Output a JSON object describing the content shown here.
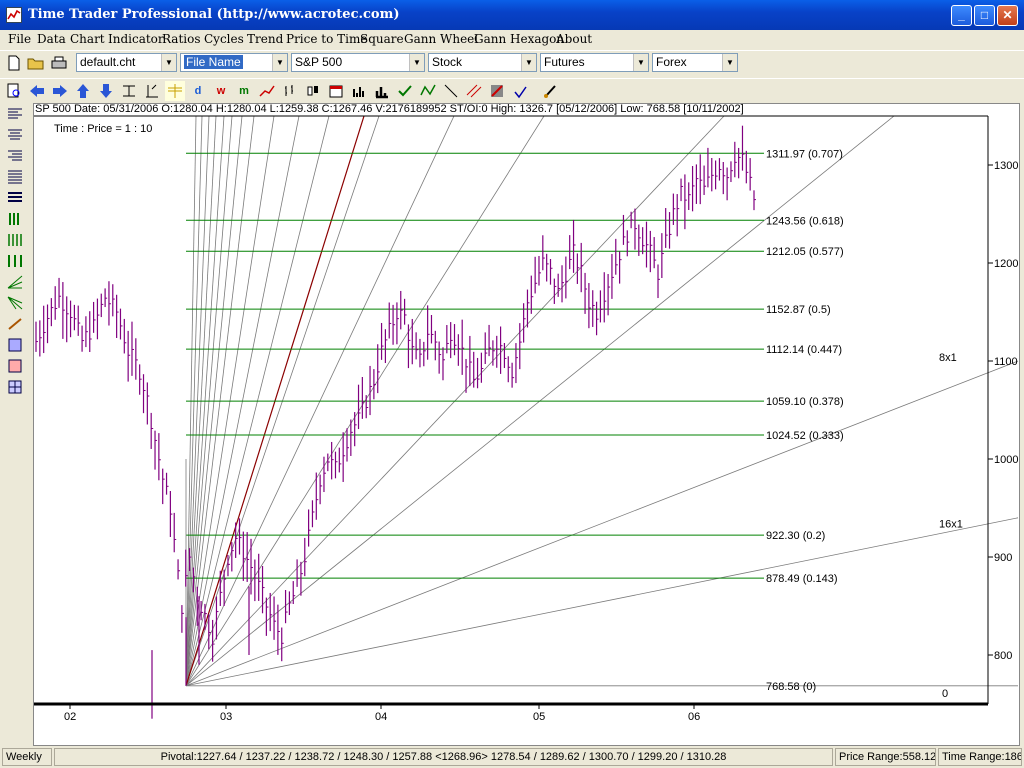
{
  "window": {
    "title": "Time Trader Professional (http://www.acrotec.com)",
    "minimize_glyph": "_",
    "maximize_glyph": "□",
    "close_glyph": "✕"
  },
  "menu": [
    "File",
    "Data",
    "Chart",
    "Indicator",
    "Ratios",
    "Cycles",
    "Trend",
    "Price to Time",
    "Square",
    "Gann Wheel",
    "Gann Hexagon",
    "About"
  ],
  "toolbar": {
    "chart_file": "default.cht",
    "file_name": "File Name",
    "symbol": "S&P 500",
    "stock": "Stock",
    "futures": "Futures",
    "forex": "Forex",
    "d_label": "d",
    "w_label": "w",
    "m_label": "m"
  },
  "colors": {
    "price_bars": "#800080",
    "fib_lines": "#008000",
    "gann_lines": "#7a7a7a",
    "primary_gann": "#8b0000"
  },
  "info_line": "SP 500  Date: 05/31/2006 O:1280.04  H:1280.04  L:1259.38  C:1267.46  V:2176189952 ST/OI:0       High: 1326.7 [05/12/2006]  Low: 768.58 [10/11/2002]",
  "chart_data": {
    "type": "bar",
    "subtitle": "Time : Price = 1 : 10",
    "y_ticks": [
      "1300",
      "1200",
      "1100",
      "1000",
      "900",
      "800"
    ],
    "x_ticks": [
      "02",
      "03",
      "04",
      "05",
      "06"
    ],
    "ylim": [
      750,
      1350
    ],
    "fib_levels": [
      {
        "price": 1311.97,
        "label": "1311.97  (0.707)"
      },
      {
        "price": 1243.56,
        "label": "1243.56  (0.618)"
      },
      {
        "price": 1212.05,
        "label": "1212.05  (0.577)"
      },
      {
        "price": 1152.87,
        "label": "1152.87  (0.5)"
      },
      {
        "price": 1112.14,
        "label": "1112.14  (0.447)"
      },
      {
        "price": 1059.1,
        "label": "1059.10  (0.378)"
      },
      {
        "price": 1024.52,
        "label": "1024.52  (0.333)"
      },
      {
        "price": 922.3,
        "label": "922.30  (0.2)"
      },
      {
        "price": 878.49,
        "label": "878.49  (0.143)"
      },
      {
        "price": 768.58,
        "label": "768.58  (0)"
      }
    ],
    "fan_labels": [
      "8x1",
      "16x1",
      "0"
    ],
    "price_series": [
      {
        "t": 0,
        "p": 1120
      },
      {
        "t": 3,
        "p": 1145
      },
      {
        "t": 6,
        "p": 1165
      },
      {
        "t": 9,
        "p": 1150
      },
      {
        "t": 12,
        "p": 1120
      },
      {
        "t": 15,
        "p": 1135
      },
      {
        "t": 18,
        "p": 1165
      },
      {
        "t": 21,
        "p": 1150
      },
      {
        "t": 24,
        "p": 1110
      },
      {
        "t": 27,
        "p": 1090
      },
      {
        "t": 29,
        "p": 1060
      },
      {
        "t": 31,
        "p": 1020
      },
      {
        "t": 33,
        "p": 980
      },
      {
        "t": 35,
        "p": 950
      },
      {
        "t": 37,
        "p": 880
      },
      {
        "t": 38,
        "p": 850
      },
      {
        "t": 40,
        "p": 900
      },
      {
        "t": 42,
        "p": 860
      },
      {
        "t": 44,
        "p": 840
      },
      {
        "t": 46,
        "p": 820
      },
      {
        "t": 48,
        "p": 860
      },
      {
        "t": 50,
        "p": 900
      },
      {
        "t": 52,
        "p": 920
      },
      {
        "t": 54,
        "p": 905
      },
      {
        "t": 56,
        "p": 890
      },
      {
        "t": 58,
        "p": 870
      },
      {
        "t": 60,
        "p": 850
      },
      {
        "t": 62,
        "p": 830
      },
      {
        "t": 64,
        "p": 820
      },
      {
        "t": 66,
        "p": 850
      },
      {
        "t": 68,
        "p": 870
      },
      {
        "t": 70,
        "p": 900
      },
      {
        "t": 72,
        "p": 940
      },
      {
        "t": 74,
        "p": 980
      },
      {
        "t": 76,
        "p": 1000
      },
      {
        "t": 78,
        "p": 990
      },
      {
        "t": 80,
        "p": 1010
      },
      {
        "t": 82,
        "p": 1030
      },
      {
        "t": 84,
        "p": 1040
      },
      {
        "t": 86,
        "p": 1060
      },
      {
        "t": 88,
        "p": 1080
      },
      {
        "t": 90,
        "p": 1110
      },
      {
        "t": 92,
        "p": 1130
      },
      {
        "t": 94,
        "p": 1150
      },
      {
        "t": 96,
        "p": 1145
      },
      {
        "t": 98,
        "p": 1110
      },
      {
        "t": 100,
        "p": 1100
      },
      {
        "t": 102,
        "p": 1130
      },
      {
        "t": 104,
        "p": 1120
      },
      {
        "t": 106,
        "p": 1100
      },
      {
        "t": 108,
        "p": 1130
      },
      {
        "t": 110,
        "p": 1120
      },
      {
        "t": 112,
        "p": 1100
      },
      {
        "t": 114,
        "p": 1080
      },
      {
        "t": 116,
        "p": 1090
      },
      {
        "t": 118,
        "p": 1110
      },
      {
        "t": 120,
        "p": 1120
      },
      {
        "t": 122,
        "p": 1110
      },
      {
        "t": 124,
        "p": 1090
      },
      {
        "t": 126,
        "p": 1120
      },
      {
        "t": 128,
        "p": 1160
      },
      {
        "t": 130,
        "p": 1180
      },
      {
        "t": 132,
        "p": 1200
      },
      {
        "t": 134,
        "p": 1190
      },
      {
        "t": 136,
        "p": 1170
      },
      {
        "t": 138,
        "p": 1190
      },
      {
        "t": 140,
        "p": 1210
      },
      {
        "t": 142,
        "p": 1190
      },
      {
        "t": 144,
        "p": 1160
      },
      {
        "t": 146,
        "p": 1150
      },
      {
        "t": 148,
        "p": 1170
      },
      {
        "t": 150,
        "p": 1190
      },
      {
        "t": 152,
        "p": 1210
      },
      {
        "t": 154,
        "p": 1230
      },
      {
        "t": 156,
        "p": 1240
      },
      {
        "t": 158,
        "p": 1225
      },
      {
        "t": 160,
        "p": 1210
      },
      {
        "t": 162,
        "p": 1190
      },
      {
        "t": 164,
        "p": 1220
      },
      {
        "t": 166,
        "p": 1250
      },
      {
        "t": 168,
        "p": 1270
      },
      {
        "t": 170,
        "p": 1265
      },
      {
        "t": 172,
        "p": 1285
      },
      {
        "t": 174,
        "p": 1275
      },
      {
        "t": 176,
        "p": 1290
      },
      {
        "t": 178,
        "p": 1300
      },
      {
        "t": 180,
        "p": 1290
      },
      {
        "t": 182,
        "p": 1310
      },
      {
        "t": 184,
        "p": 1305
      },
      {
        "t": 186,
        "p": 1280
      },
      {
        "t": 187,
        "p": 1265
      }
    ]
  },
  "status": {
    "period": "Weekly",
    "pivotal": "Pivotal:1227.64 / 1237.22 / 1238.72 / 1248.30 / 1257.88 <1268.96> 1278.54 / 1289.62 / 1300.70 / 1299.20 / 1310.28",
    "price_range": "Price Range:558.12",
    "time_range": "Time Range:186"
  }
}
